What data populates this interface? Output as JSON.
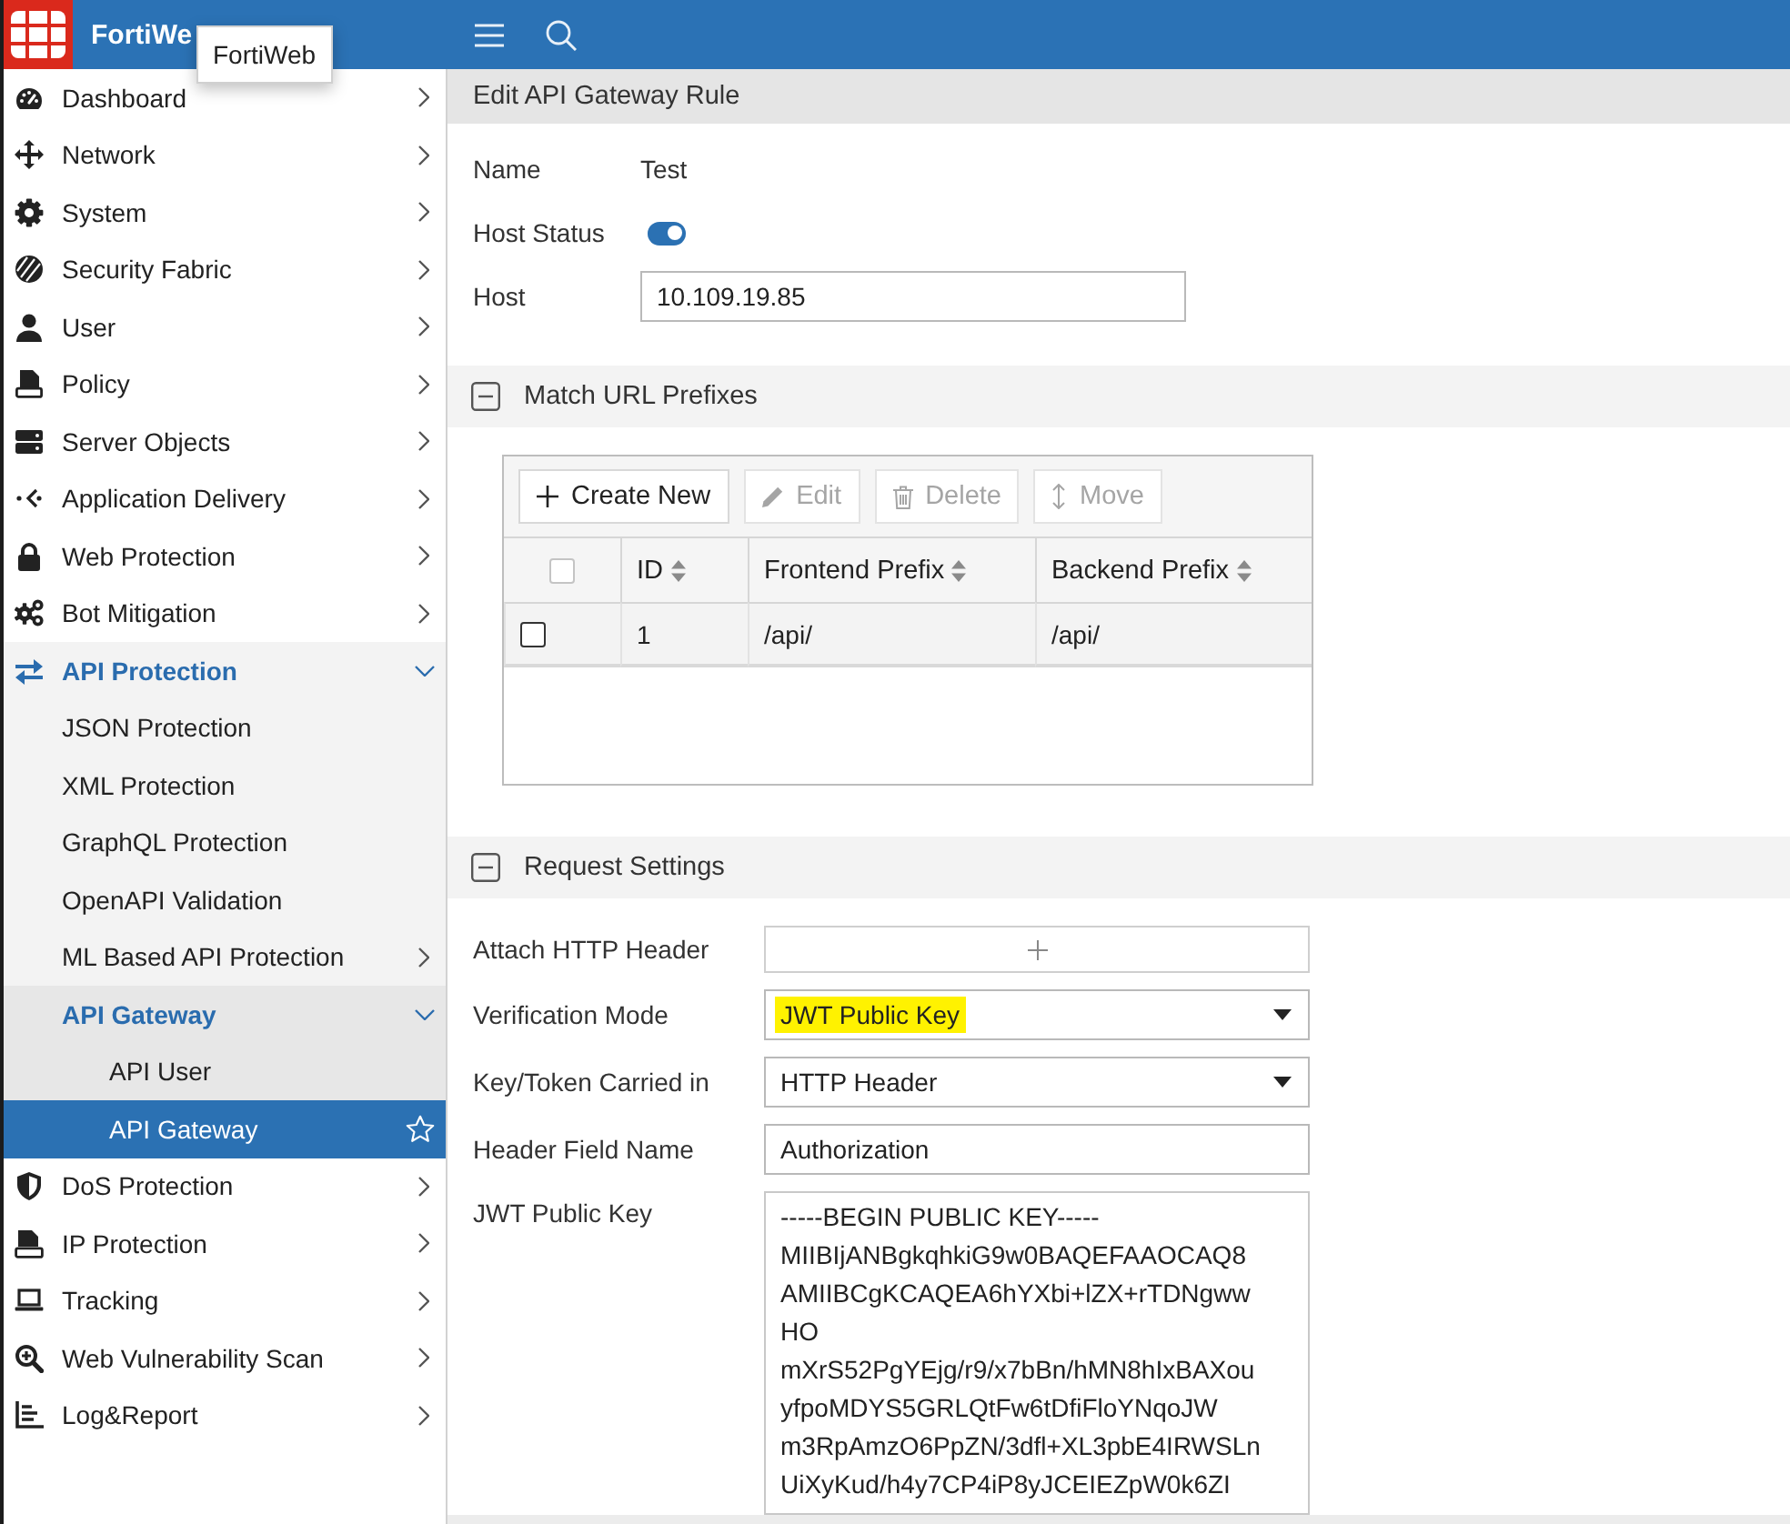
{
  "topbar": {
    "brand": "FortiWe",
    "tooltip": "FortiWeb"
  },
  "sidebar": {
    "items": [
      {
        "label": "Dashboard",
        "expanded": false,
        "selected": false
      },
      {
        "label": "Network",
        "expanded": false,
        "selected": false
      },
      {
        "label": "System",
        "expanded": false,
        "selected": false
      },
      {
        "label": "Security Fabric",
        "expanded": false,
        "selected": false
      },
      {
        "label": "User",
        "expanded": false,
        "selected": false
      },
      {
        "label": "Policy",
        "expanded": false,
        "selected": false
      },
      {
        "label": "Server Objects",
        "expanded": false,
        "selected": false
      },
      {
        "label": "Application Delivery",
        "expanded": false,
        "selected": false
      },
      {
        "label": "Web Protection",
        "expanded": false,
        "selected": false
      },
      {
        "label": "Bot Mitigation",
        "expanded": false,
        "selected": false
      },
      {
        "label": "API Protection",
        "expanded": true,
        "selected": false,
        "children": [
          {
            "label": "JSON Protection",
            "selected": false
          },
          {
            "label": "XML Protection",
            "selected": false
          },
          {
            "label": "GraphQL Protection",
            "selected": false
          },
          {
            "label": "OpenAPI Validation",
            "selected": false
          },
          {
            "label": "ML Based API Protection",
            "expanded": false,
            "selected": false
          },
          {
            "label": "API Gateway",
            "expanded": true,
            "selected": false,
            "children": [
              {
                "label": "API User",
                "selected": false
              },
              {
                "label": "API Gateway",
                "selected": true
              }
            ]
          }
        ]
      },
      {
        "label": "DoS Protection",
        "expanded": false,
        "selected": false
      },
      {
        "label": "IP Protection",
        "expanded": false,
        "selected": false
      },
      {
        "label": "Tracking",
        "expanded": false,
        "selected": false
      },
      {
        "label": "Web Vulnerability Scan",
        "expanded": false,
        "selected": false
      },
      {
        "label": "Log&Report",
        "expanded": false,
        "selected": false
      }
    ]
  },
  "page": {
    "title": "Edit API Gateway Rule",
    "fields": [
      {
        "kind": "text",
        "label": "Name",
        "value": "Test"
      },
      {
        "kind": "toggle",
        "label": "Host Status",
        "on": true
      },
      {
        "kind": "input",
        "label": "Host",
        "value": "10.109.19.85"
      }
    ],
    "sections": [
      {
        "kind": "table",
        "title": "Match URL Prefixes",
        "expanded": true,
        "toolbar": [
          {
            "label": "Create New",
            "disabled": false
          },
          {
            "label": "Edit",
            "disabled": true
          },
          {
            "label": "Delete",
            "disabled": true
          },
          {
            "label": "Move",
            "disabled": true
          }
        ],
        "select_all_checked": false,
        "columns": [
          "ID",
          "Frontend Prefix",
          "Backend Prefix"
        ],
        "rows": [
          {
            "checked": false,
            "cells": [
              "1",
              "/api/",
              "/api/"
            ]
          }
        ]
      },
      {
        "kind": "form",
        "title": "Request Settings",
        "expanded": true,
        "fields": [
          {
            "kind": "add",
            "label": "Attach HTTP Header"
          },
          {
            "kind": "select",
            "label": "Verification Mode",
            "value": "JWT Public Key",
            "highlighted": true
          },
          {
            "kind": "select",
            "label": "Key/Token Carried in",
            "value": "HTTP Header",
            "highlighted": false
          },
          {
            "kind": "input",
            "label": "Header Field Name",
            "value": "Authorization"
          },
          {
            "kind": "textarea",
            "label": "JWT Public Key",
            "lines": [
              "-----BEGIN PUBLIC KEY-----",
              "MIIBIjANBgkqhkiG9w0BAQEFAAOCAQ8",
              "AMIIBCgKCAQEA6hYXbi+lZX+rTDNgww",
              "HO",
              "mXrS52PgYEjg/r9/x7bBn/hMN8hIxBAXou",
              "yfpoMDYS5GRLQtFw6tDfiFloYNqoJW",
              "m3RpAmzO6PpZN/3dfl+XL3pbE4IRWSLn",
              "UiXyKud/h4y7CP4iP8yJCEIEZpW0k6ZI"
            ]
          }
        ]
      }
    ]
  }
}
